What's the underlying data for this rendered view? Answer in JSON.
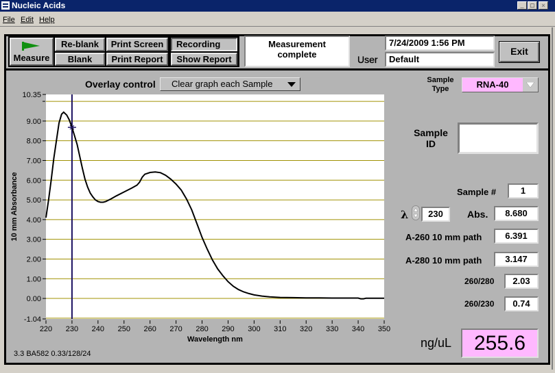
{
  "window": {
    "title": "Nucleic Acids",
    "controls": [
      "_",
      "□",
      "×"
    ]
  },
  "menu": [
    "File",
    "Edit",
    "Help"
  ],
  "toolbar": {
    "measure_label": "Measure",
    "reblank_label": "Re-blank",
    "blank_label": "Blank",
    "print_screen_label": "Print Screen",
    "print_report_label": "Print Report",
    "recording_label": "Recording",
    "show_report_label": "Show Report",
    "status_line1": "Measurement",
    "status_line2": "complete",
    "datetime": "7/24/2009  1:56 PM",
    "user_label": "User",
    "user_value": "Default",
    "exit_label": "Exit"
  },
  "overlay": {
    "label": "Overlay control",
    "selected": "Clear graph each Sample"
  },
  "sample": {
    "type_label_1": "Sample",
    "type_label_2": "Type",
    "type_value": "RNA-40",
    "id_label_1": "Sample",
    "id_label_2": "ID",
    "id_value": "",
    "number_label": "Sample #",
    "number_value": "1",
    "lambda_symbol": "λ",
    "lambda_value": "230",
    "abs_label": "Abs.",
    "abs_value": "8.680",
    "a260_label": "A-260 10 mm path",
    "a260_value": "6.391",
    "a280_label": "A-280 10 mm path",
    "a280_value": "3.147",
    "r260_280_label": "260/280",
    "r260_280_value": "2.03",
    "r260_230_label": "260/230",
    "r260_230_value": "0.74",
    "conc_label": "ng/uL",
    "conc_value": "255.6"
  },
  "colors": {
    "highlight_pink": "#ffb8ff",
    "cursor_line": "#1a1060",
    "grid": "#a09000",
    "flag_green": "#109010"
  },
  "footer": {
    "version": "3.3 BA582 0.33/128/24"
  },
  "chart_data": {
    "type": "line",
    "title": "",
    "xlabel": "Wavelength nm",
    "ylabel": "10 mm Absorbance",
    "xlim": [
      220,
      350
    ],
    "ylim": [
      -1.04,
      10.35
    ],
    "xticks": [
      220,
      230,
      240,
      250,
      260,
      270,
      280,
      290,
      300,
      310,
      320,
      330,
      340,
      350
    ],
    "yticks": [
      {
        "value": 10.35,
        "label": "10.35"
      },
      {
        "value": 9.0,
        "label": "9.00"
      },
      {
        "value": 8.0,
        "label": "8.00"
      },
      {
        "value": 7.0,
        "label": "7.00"
      },
      {
        "value": 6.0,
        "label": "6.00"
      },
      {
        "value": 5.0,
        "label": "5.00"
      },
      {
        "value": 4.0,
        "label": "4.00"
      },
      {
        "value": 3.0,
        "label": "3.00"
      },
      {
        "value": 2.0,
        "label": "2.00"
      },
      {
        "value": 1.0,
        "label": "1.00"
      },
      {
        "value": 0.0,
        "label": "0.00"
      },
      {
        "value": -1.04,
        "label": "-1.04"
      }
    ],
    "gridlines_y": [
      10.0,
      9.0,
      8.0,
      7.0,
      6.0,
      5.0,
      4.0,
      3.0,
      2.0,
      1.0,
      0.0,
      -1.0
    ],
    "cursor_x": 230,
    "cursor_y": 8.68,
    "series": [
      {
        "name": "Sample 1",
        "x": [
          220,
          221,
          222,
          223,
          224,
          225,
          226,
          226.8,
          228,
          229,
          230,
          231,
          232,
          233,
          234,
          235,
          236,
          237,
          238,
          239,
          240,
          241,
          242,
          243,
          245,
          247,
          250,
          253,
          255,
          256,
          257,
          258,
          260,
          262,
          264,
          266,
          268,
          270,
          272,
          274,
          276,
          278,
          280,
          282,
          284,
          286,
          288,
          290,
          292,
          294,
          296,
          298,
          300,
          303,
          306,
          310,
          315,
          320,
          325,
          330,
          335,
          340,
          341,
          342,
          343,
          345,
          350
        ],
        "y": [
          4.1,
          5.0,
          6.0,
          7.1,
          8.0,
          8.9,
          9.35,
          9.45,
          9.3,
          9.05,
          8.68,
          8.25,
          7.8,
          7.2,
          6.6,
          6.05,
          5.65,
          5.35,
          5.15,
          5.0,
          4.92,
          4.88,
          4.88,
          4.92,
          5.05,
          5.2,
          5.4,
          5.6,
          5.75,
          5.9,
          6.15,
          6.3,
          6.39,
          6.42,
          6.38,
          6.25,
          6.05,
          5.8,
          5.5,
          5.05,
          4.5,
          3.8,
          3.1,
          2.5,
          1.95,
          1.5,
          1.15,
          0.85,
          0.62,
          0.45,
          0.33,
          0.25,
          0.18,
          0.12,
          0.08,
          0.05,
          0.04,
          0.03,
          0.03,
          0.02,
          0.02,
          0.02,
          -0.02,
          -0.02,
          0.01,
          0.01,
          0.01
        ]
      }
    ]
  }
}
